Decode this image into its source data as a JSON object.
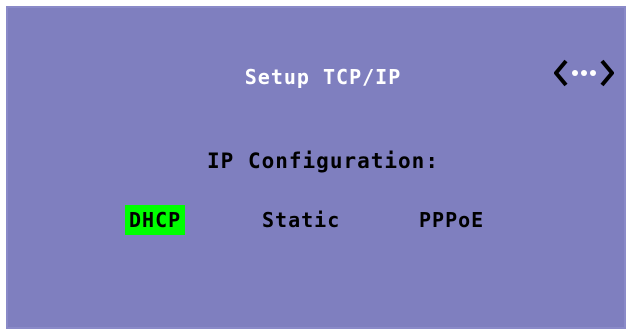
{
  "screen": {
    "title": "Setup TCP/IP",
    "icon": "network-icon",
    "section_label": "IP Configuration:",
    "options": [
      {
        "label": "DHCP",
        "selected": true
      },
      {
        "label": "Static",
        "selected": false
      },
      {
        "label": "PPPoE",
        "selected": false
      }
    ],
    "colors": {
      "background": "#7f7fbf",
      "title_text": "#ffffff",
      "body_text": "#000000",
      "selection_highlight": "#00ff00"
    }
  }
}
